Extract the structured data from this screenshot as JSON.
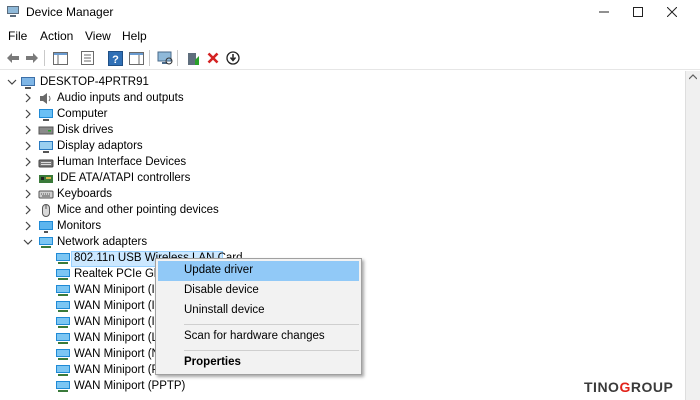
{
  "window": {
    "title": "Device Manager"
  },
  "menu": [
    "File",
    "Action",
    "View",
    "Help"
  ],
  "toolbar": {
    "buttons": [
      "back-arrow-icon",
      "forward-arrow-icon",
      "show-hide-console-tree-icon",
      "properties-icon",
      "help-icon",
      "action-pane-icon",
      "scan-hardware-icon",
      "update-driver-icon",
      "uninstall-icon",
      "disable-device-icon"
    ]
  },
  "tree": {
    "root": "DESKTOP-4PRTR91",
    "categories": [
      {
        "label": "Audio inputs and outputs",
        "icon": "speaker-icon"
      },
      {
        "label": "Computer",
        "icon": "computer-icon"
      },
      {
        "label": "Disk drives",
        "icon": "disk-drive-icon"
      },
      {
        "label": "Display adaptors",
        "icon": "display-adapter-icon"
      },
      {
        "label": "Human Interface Devices",
        "icon": "hid-icon"
      },
      {
        "label": "IDE ATA/ATAPI controllers",
        "icon": "ide-controller-icon"
      },
      {
        "label": "Keyboards",
        "icon": "keyboard-icon"
      },
      {
        "label": "Mice and other pointing devices",
        "icon": "mouse-icon"
      },
      {
        "label": "Monitors",
        "icon": "monitor-icon"
      },
      {
        "label": "Network adapters",
        "icon": "network-adapter-icon"
      }
    ],
    "network_children": [
      "802.11n USB Wireless LAN Card",
      "Realtek PCIe GbE",
      "WAN Miniport (I",
      "WAN Miniport (I",
      "WAN Miniport (I",
      "WAN Miniport (L",
      "WAN Miniport (N",
      "WAN Miniport (P",
      "WAN Miniport (PPTP)"
    ]
  },
  "context_menu": {
    "items": [
      "Update driver",
      "Disable device",
      "Uninstall device",
      "Scan for hardware changes",
      "Properties"
    ]
  },
  "watermark": {
    "part1": "TINO",
    "part2": "G",
    "part3": "ROUP"
  }
}
